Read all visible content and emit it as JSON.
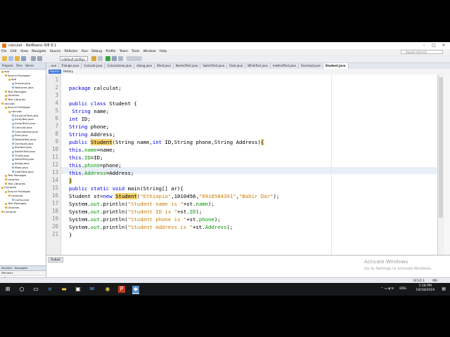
{
  "window": {
    "title": "calculat - NetBeans IDE 8.1",
    "controls": [
      "–",
      "□",
      "×"
    ]
  },
  "menubar": {
    "items": [
      "File",
      "Edit",
      "View",
      "Navigate",
      "Source",
      "Refactor",
      "Run",
      "Debug",
      "Profile",
      "Team",
      "Tools",
      "Window",
      "Help"
    ],
    "search_placeholder": "Search (Ctrl+I)"
  },
  "toolbar": {
    "config": "<default config>"
  },
  "projects_panel": {
    "tabs": [
      "Projects",
      "Files",
      "Servic"
    ],
    "tree": [
      {
        "label": "app",
        "depth": 0,
        "kind": "folder"
      },
      {
        "label": "Source Packages",
        "depth": 1,
        "kind": "folder"
      },
      {
        "label": "app",
        "depth": 2,
        "kind": "folder"
      },
      {
        "label": "Simple.java",
        "depth": 3,
        "kind": "file"
      },
      {
        "label": "Welcome.java",
        "depth": 3,
        "kind": "file"
      },
      {
        "label": "Test Packages",
        "depth": 1,
        "kind": "folder"
      },
      {
        "label": "Libraries",
        "depth": 1,
        "kind": "folder"
      },
      {
        "label": "Test Libraries",
        "depth": 1,
        "kind": "folder"
      },
      {
        "label": "calculat",
        "depth": 0,
        "kind": "folder"
      },
      {
        "label": "Source Packages",
        "depth": 1,
        "kind": "folder"
      },
      {
        "label": "calculat",
        "depth": 2,
        "kind": "folder"
      },
      {
        "label": "ArrayListTest.java",
        "depth": 3,
        "kind": "file"
      },
      {
        "label": "ArrayTest.java",
        "depth": 3,
        "kind": "file"
      },
      {
        "label": "ArrayTest2.java",
        "depth": 3,
        "kind": "file"
      },
      {
        "label": "Calculat.java",
        "depth": 3,
        "kind": "file"
      },
      {
        "label": "Calculatarea.java",
        "depth": 3,
        "kind": "file"
      },
      {
        "label": "Elsel.java",
        "depth": 3,
        "kind": "file"
      },
      {
        "label": "NestedTest.java",
        "depth": 3,
        "kind": "file"
      },
      {
        "label": "Overload.java",
        "depth": 3,
        "kind": "file"
      },
      {
        "label": "Student.java",
        "depth": 3,
        "kind": "file"
      },
      {
        "label": "SwitchTest.java",
        "depth": 3,
        "kind": "file"
      },
      {
        "label": "ThisId.java",
        "depth": 3,
        "kind": "file"
      },
      {
        "label": "WhileTest.java",
        "depth": 3,
        "kind": "file"
      },
      {
        "label": "dialog.java",
        "depth": 3,
        "kind": "file"
      },
      {
        "label": "iftest.java",
        "depth": 3,
        "kind": "file"
      },
      {
        "label": "methTest.java",
        "depth": 3,
        "kind": "file"
      },
      {
        "label": "Test Packages",
        "depth": 1,
        "kind": "folder"
      },
      {
        "label": "Libraries",
        "depth": 1,
        "kind": "folder"
      },
      {
        "label": "Test Libraries",
        "depth": 1,
        "kind": "folder"
      },
      {
        "label": "Compula",
        "depth": 0,
        "kind": "folder"
      },
      {
        "label": "Source Packages",
        "depth": 1,
        "kind": "folder"
      },
      {
        "label": "compula",
        "depth": 2,
        "kind": "folder"
      },
      {
        "label": "Comp.java",
        "depth": 3,
        "kind": "file"
      },
      {
        "label": "Test Packages",
        "depth": 1,
        "kind": "folder"
      },
      {
        "label": "Libraries",
        "depth": 1,
        "kind": "folder"
      },
      {
        "label": "Compula",
        "depth": 0,
        "kind": "folder"
      }
    ]
  },
  "navigator": {
    "title": "Student - Navigator",
    "filter": "Members",
    "items": [
      "Student",
      "Student(String name, ...",
      "main(String[] ar)",
      "Address : String",
      "ID : int",
      "name : String",
      "phone : String"
    ]
  },
  "editor_tabs": [
    "...ava",
    "Triangle.java",
    "Calculat.java",
    "Calculatarea.java",
    "dialog.java",
    "iftest.java",
    "NestedTest.java",
    "SwitchTest.java",
    "Elsel.java",
    "WhileTest.java",
    "methodTest.java",
    "Overload.java",
    "Student.java"
  ],
  "active_tab": "Student.java",
  "source_bar": {
    "source": "Source",
    "history": "History"
  },
  "code": [
    {
      "n": "1",
      "segs": [
        [
          "",
          ""
        ]
      ]
    },
    {
      "n": "2",
      "segs": [
        [
          "kw",
          "package"
        ],
        [
          "",
          " calculat;"
        ]
      ]
    },
    {
      "n": "3",
      "segs": [
        [
          "",
          ""
        ]
      ]
    },
    {
      "n": "4",
      "segs": [
        [
          "kw",
          "public class"
        ],
        [
          "",
          " Student {"
        ]
      ]
    },
    {
      "n": "5",
      "segs": [
        [
          "kw",
          " String"
        ],
        [
          "",
          " name;"
        ]
      ]
    },
    {
      "n": "6",
      "segs": [
        [
          "kw",
          "int"
        ],
        [
          "",
          " ID;"
        ]
      ]
    },
    {
      "n": "7",
      "segs": [
        [
          "kw",
          "String"
        ],
        [
          "",
          " phone;"
        ]
      ]
    },
    {
      "n": "8",
      "segs": [
        [
          "kw",
          "String"
        ],
        [
          "",
          " Address;"
        ]
      ]
    },
    {
      "n": "9",
      "segs": [
        [
          "kw",
          "public"
        ],
        [
          "",
          " "
        ],
        [
          "hl",
          "Student"
        ],
        [
          "",
          "(String name,"
        ],
        [
          "kw",
          "int"
        ],
        [
          "",
          " ID,String phone,String Address)"
        ],
        [
          "hl",
          "{"
        ]
      ]
    },
    {
      "n": "10",
      "segs": [
        [
          "kw",
          "this"
        ],
        [
          "",
          "."
        ],
        [
          "fld",
          "name"
        ],
        [
          "",
          "=name;"
        ]
      ]
    },
    {
      "n": "11",
      "segs": [
        [
          "kw",
          "this"
        ],
        [
          "",
          "."
        ],
        [
          "fld",
          "ID"
        ],
        [
          "",
          "=ID;"
        ]
      ]
    },
    {
      "n": "12",
      "segs": [
        [
          "kw",
          "this"
        ],
        [
          "",
          "."
        ],
        [
          "fld",
          "phone"
        ],
        [
          "",
          "=phone;"
        ]
      ]
    },
    {
      "n": "13",
      "segs": [
        [
          "kw",
          "this"
        ],
        [
          "",
          "."
        ],
        [
          "fld",
          "Address"
        ],
        [
          "",
          "=Address;"
        ]
      ]
    },
    {
      "n": "14",
      "segs": [
        [
          "hl",
          "}"
        ]
      ]
    },
    {
      "n": "15",
      "segs": [
        [
          "kw",
          "public static void"
        ],
        [
          "",
          " main(String[] ar){"
        ]
      ]
    },
    {
      "n": "16",
      "segs": [
        [
          "",
          "Student st="
        ],
        [
          "kw",
          "new"
        ],
        [
          "",
          " "
        ],
        [
          "hl",
          "Student"
        ],
        [
          "",
          "("
        ],
        [
          "str",
          "\"Ethiopia\""
        ],
        [
          "",
          ",1010456,"
        ],
        [
          "str",
          "\"0918584391\""
        ],
        [
          "",
          ","
        ],
        [
          "str",
          "\"Bahir Dar\""
        ],
        [
          "",
          ");"
        ]
      ]
    },
    {
      "n": "17",
      "segs": [
        [
          "",
          "System."
        ],
        [
          "fldi",
          "out"
        ],
        [
          "",
          ".println("
        ],
        [
          "str",
          "\"Student name is \""
        ],
        [
          "",
          "+st."
        ],
        [
          "fld",
          "name"
        ],
        [
          "",
          ");"
        ]
      ]
    },
    {
      "n": "18",
      "segs": [
        [
          "",
          "System."
        ],
        [
          "fldi",
          "out"
        ],
        [
          "",
          ".println("
        ],
        [
          "str",
          "\"Student ID is \""
        ],
        [
          "",
          "+st."
        ],
        [
          "fld",
          "ID"
        ],
        [
          "",
          ");"
        ]
      ]
    },
    {
      "n": "19",
      "segs": [
        [
          "",
          "System."
        ],
        [
          "fldi",
          "out"
        ],
        [
          "",
          ".println("
        ],
        [
          "str",
          "\"Student phone is \""
        ],
        [
          "",
          "+st."
        ],
        [
          "fld",
          "phone"
        ],
        [
          "",
          ");"
        ]
      ]
    },
    {
      "n": "20",
      "segs": [
        [
          "",
          "System."
        ],
        [
          "fldi",
          "out"
        ],
        [
          "",
          ".println("
        ],
        [
          "str",
          "\"Student Address is \""
        ],
        [
          "",
          "+st."
        ],
        [
          "fld",
          "Address"
        ],
        [
          "",
          ");"
        ]
      ]
    },
    {
      "n": "21",
      "segs": [
        [
          "",
          "}"
        ]
      ]
    }
  ],
  "output": {
    "tab": "Output"
  },
  "watermark": {
    "line1": "Activate Windows",
    "line2": "Go to Settings to activate Windows."
  },
  "status": {
    "position": "14:1/1:1",
    "mode": "INS"
  },
  "taskbar": {
    "lang": "ENG",
    "time": "1:18 PM",
    "date": "10/18/2019"
  },
  "colors": {
    "keyword": "#0000e6",
    "string": "#ce7b00",
    "field": "#009900",
    "highlight": "#f8d36c"
  }
}
